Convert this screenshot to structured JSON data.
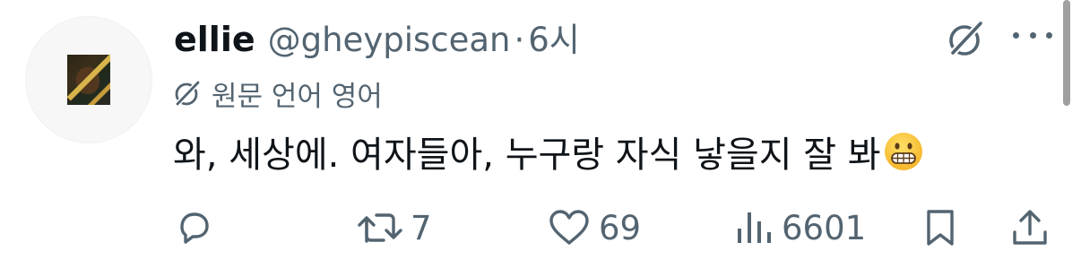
{
  "author": {
    "display_name": "ellie",
    "handle": "@gheypiscean",
    "separator": "·",
    "time": "6시"
  },
  "translation": {
    "label": "원문 언어 영어"
  },
  "tweet": {
    "text": "와, 세상에. 여자들아, 누구랑 자식 낳을지 잘 봐",
    "emoji": "grimacing-face"
  },
  "actions": {
    "replies": "",
    "retweets": "7",
    "likes": "69",
    "views": "6601"
  },
  "icons": {
    "grok": "grok-icon",
    "more": "more-icon",
    "reply": "reply-icon",
    "retweet": "retweet-icon",
    "like": "heart-icon",
    "views": "views-icon",
    "bookmark": "bookmark-icon",
    "share": "share-icon"
  },
  "colors": {
    "text": "#0f1419",
    "secondary": "#536471",
    "icon": "#536471"
  }
}
